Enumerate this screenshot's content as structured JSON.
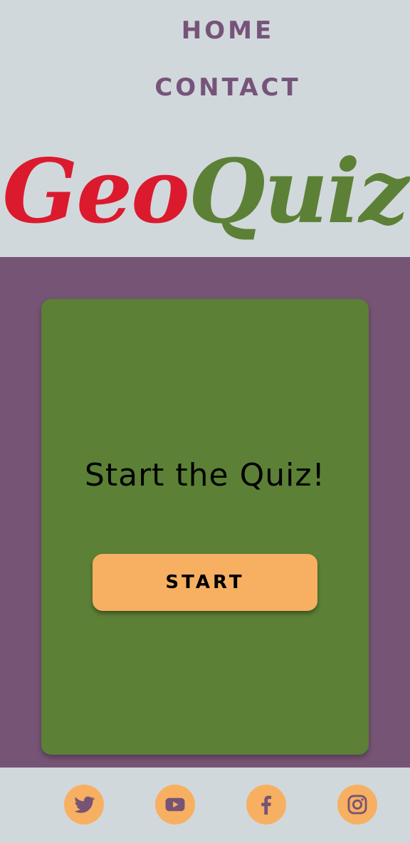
{
  "nav": {
    "home_label": "HOME",
    "contact_label": "CONTACT"
  },
  "logo": {
    "part1": "Geo",
    "part2": "Quiz",
    "part1_color": "#dc1a2e",
    "part2_color": "#5c8136"
  },
  "card": {
    "title": "Start the Quiz!",
    "start_label": "START"
  },
  "footer": {
    "social_icons": [
      "twitter-icon",
      "youtube-icon",
      "facebook-icon",
      "instagram-icon"
    ]
  },
  "colors": {
    "background": "#d1d8dc",
    "nav_text": "#76547a",
    "main_background": "#765475",
    "card_background": "#5c8136",
    "button": "#f7b061"
  }
}
